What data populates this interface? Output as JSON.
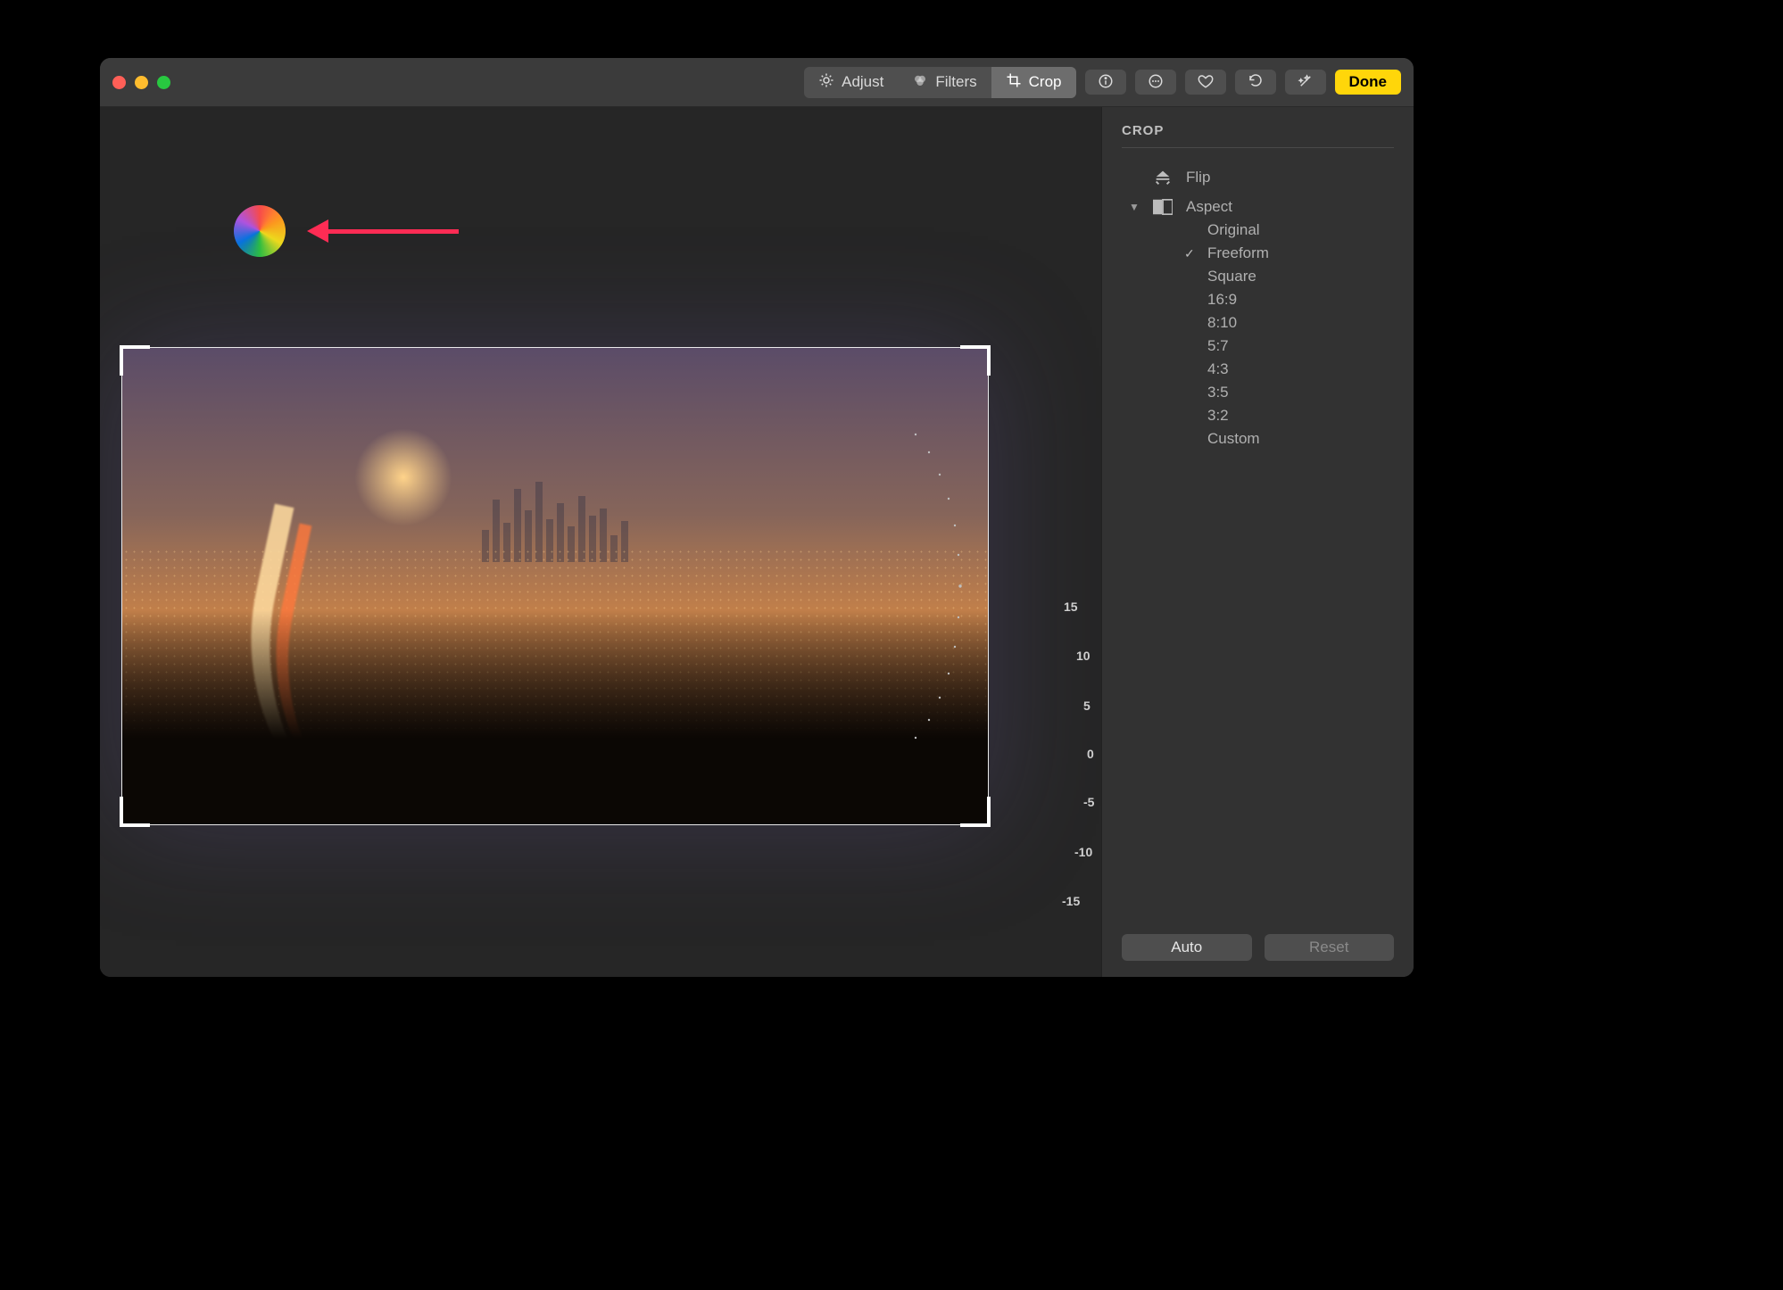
{
  "toolbar": {
    "tabs": [
      {
        "label": "Adjust",
        "active": false
      },
      {
        "label": "Filters",
        "active": false
      },
      {
        "label": "Crop",
        "active": true
      }
    ],
    "done_label": "Done"
  },
  "sidebar": {
    "title": "CROP",
    "flip_label": "Flip",
    "aspect_label": "Aspect",
    "aspect_options": [
      {
        "label": "Original",
        "selected": false
      },
      {
        "label": "Freeform",
        "selected": true
      },
      {
        "label": "Square",
        "selected": false
      },
      {
        "label": "16:9",
        "selected": false
      },
      {
        "label": "8:10",
        "selected": false
      },
      {
        "label": "5:7",
        "selected": false
      },
      {
        "label": "4:3",
        "selected": false
      },
      {
        "label": "3:5",
        "selected": false
      },
      {
        "label": "3:2",
        "selected": false
      },
      {
        "label": "Custom",
        "selected": false
      }
    ],
    "auto_label": "Auto",
    "reset_label": "Reset"
  },
  "rotate_dial": {
    "ticks": [
      "15",
      "10",
      "5",
      "0",
      "-5",
      "-10",
      "-15"
    ],
    "current": 0
  }
}
